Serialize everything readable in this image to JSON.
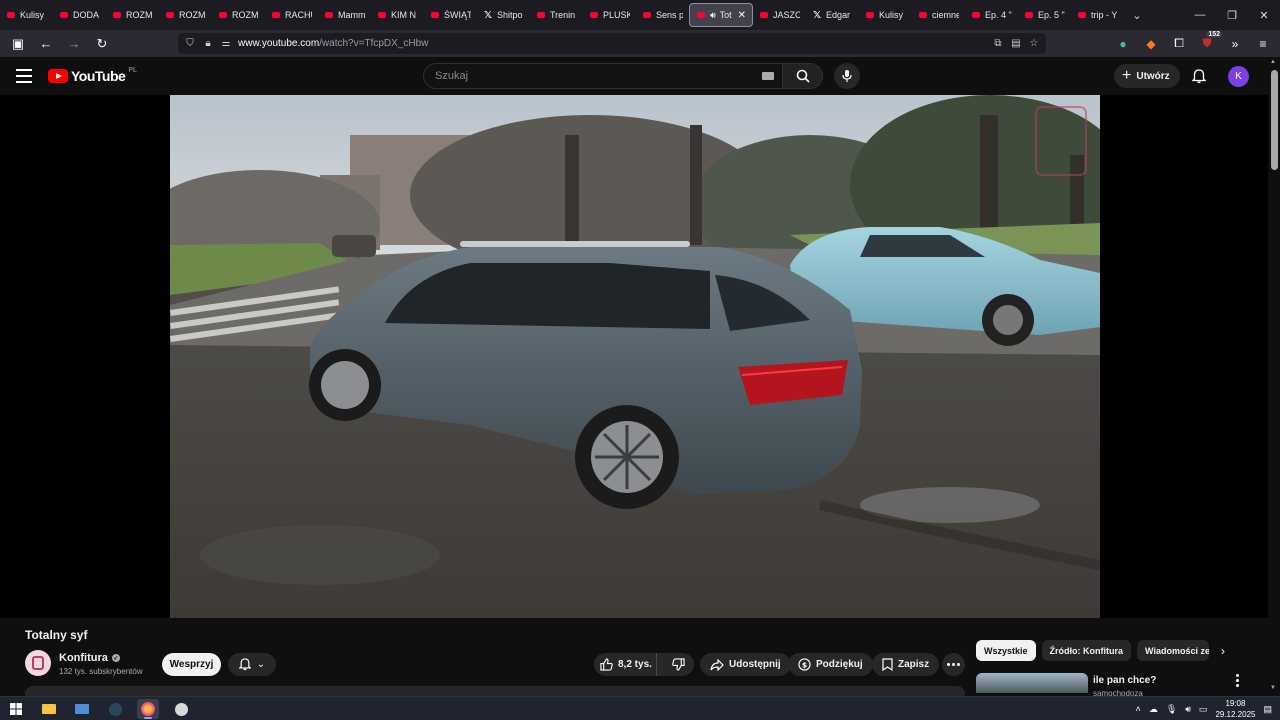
{
  "browser": {
    "tabs": [
      {
        "label": "Kulisy p",
        "icon": "youtube"
      },
      {
        "label": "DODA",
        "icon": "youtube"
      },
      {
        "label": "ROZM",
        "icon": "youtube"
      },
      {
        "label": "ROZM",
        "icon": "youtube"
      },
      {
        "label": "ROZM",
        "icon": "youtube"
      },
      {
        "label": "RACHU",
        "icon": "youtube"
      },
      {
        "label": "Mamm",
        "icon": "youtube"
      },
      {
        "label": "KIM N",
        "icon": "youtube"
      },
      {
        "label": "ŚWIĄT",
        "icon": "youtube"
      },
      {
        "label": "Shitpo",
        "icon": "x"
      },
      {
        "label": "Trenin",
        "icon": "youtube"
      },
      {
        "label": "PLUSK",
        "icon": "youtube"
      },
      {
        "label": "Sens p",
        "icon": "youtube"
      },
      {
        "label": "Tot",
        "icon": "youtube",
        "active": true
      },
      {
        "label": "JASZC",
        "icon": "youtube"
      },
      {
        "label": "Edgar",
        "icon": "x"
      },
      {
        "label": "Kulisy p",
        "icon": "youtube"
      },
      {
        "label": "ciemne",
        "icon": "youtube"
      },
      {
        "label": "Ep. 4 \"",
        "icon": "youtube"
      },
      {
        "label": "Ep. 5 \"",
        "icon": "youtube"
      },
      {
        "label": "trip - Y",
        "icon": "youtube"
      }
    ],
    "url_host": "www.youtube.com",
    "url_rest": "/watch?v=TfcpDX_cHbw",
    "extensions_badge": "152"
  },
  "youtube": {
    "logo_text": "YouTube",
    "country_code": "PL",
    "search_placeholder": "Szukaj",
    "create_label": "Utwórz",
    "avatar_letter": "K"
  },
  "video": {
    "title": "Totalny syf",
    "channel_name": "Konfitura",
    "subscribers": "132 tys. subskrybentów",
    "support_label": "Wesprzyj",
    "likes": "8,2 tys.",
    "share_label": "Udostępnij",
    "thanks_label": "Podziękuj",
    "save_label": "Zapisz"
  },
  "sidebar": {
    "chips": [
      "Wszystkie",
      "Źródło: Konfitura",
      "Wiadomości ze"
    ],
    "recommendation": {
      "title": "ile pan chce?",
      "meta": "samochodoza"
    }
  },
  "taskbar": {
    "time": "19:08",
    "date": "29.12.2025"
  },
  "colors": {
    "yt_red": "#ff0000",
    "background": "#0f0f0f",
    "avatar": "#7b3fe4"
  }
}
